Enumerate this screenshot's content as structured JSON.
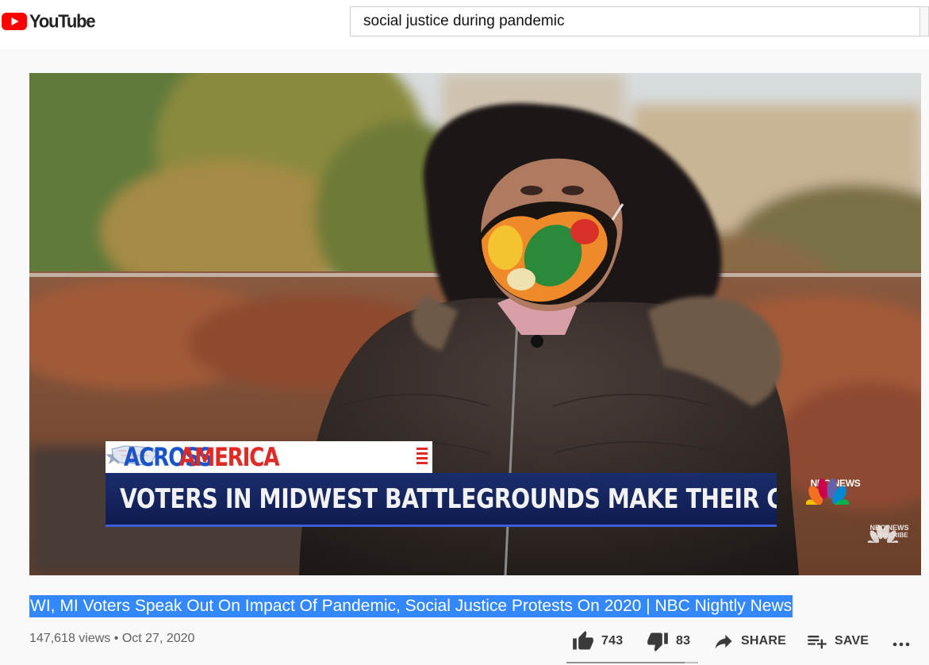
{
  "app": {
    "name": "YouTube"
  },
  "search": {
    "query": "social justice during pandemic"
  },
  "video": {
    "lower_third": {
      "kicker_left": "ACROSS",
      "kicker_right": "AMERICA",
      "headline": "VOTERS IN MIDWEST BATTLEGROUNDS MAKE THEIR CHOICE"
    },
    "network_bug": "NBC NEWS",
    "subscribe_bug": {
      "line1": "NBC NEWS",
      "line2": "SUBSCRIBE"
    }
  },
  "title": "WI, MI Voters Speak Out On Impact Of Pandemic, Social Justice Protests On 2020 | NBC Nightly News",
  "meta": {
    "views": "147,618 views",
    "separator": "•",
    "date": "Oct 27, 2020"
  },
  "actions": {
    "likes": "743",
    "dislikes": "83",
    "share": "SHARE",
    "save": "SAVE"
  },
  "icons": {
    "logo": "youtube-logo-icon",
    "like": "thumbs-up-icon",
    "dislike": "thumbs-down-icon",
    "share": "share-arrow-icon",
    "save": "playlist-add-icon",
    "more": "more-horizontal-icon"
  },
  "colors": {
    "brand_red": "#ff0000",
    "title_highlight": "#3388ff",
    "banner_blue": "#1a54c8",
    "banner_red": "#e02a26"
  },
  "sentiment": {
    "like_ratio": 0.9
  }
}
